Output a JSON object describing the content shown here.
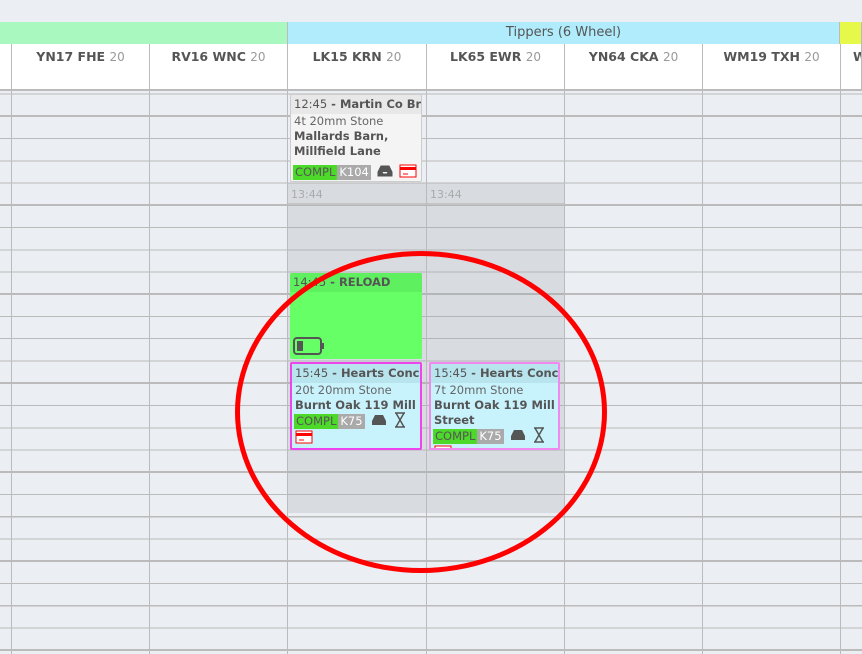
{
  "groups": [
    {
      "label": "",
      "color": "#a8f8c0"
    },
    {
      "label": "Tippers (6 Wheel)",
      "color": "#b0ecfc"
    },
    {
      "label": "",
      "color": "#e6f84a"
    }
  ],
  "columns": [
    {
      "reg": "YN17 FHE",
      "count": "20"
    },
    {
      "reg": "RV16 WNC",
      "count": "20"
    },
    {
      "reg": "LK15 KRN",
      "count": "20"
    },
    {
      "reg": "LK65 EWR",
      "count": "20"
    },
    {
      "reg": "YN64 CKA",
      "count": "20"
    },
    {
      "reg": "WM19 TXH",
      "count": "20"
    },
    {
      "reg": "W",
      "count": ""
    }
  ],
  "unavailable": {
    "label": "13:44"
  },
  "jobs": [
    {
      "time": "12:45",
      "customer": "Martin Co Brothers",
      "load": "4t 20mm Stone",
      "address": "Mallards Barn, Millfield Lane",
      "status": "COMPL",
      "ticket": "K104"
    },
    {
      "time": "14:45",
      "title": "RELOAD"
    },
    {
      "time": "15:45",
      "customer": "Hearts Concrete",
      "load": "20t 20mm Stone",
      "address": "Burnt Oak 119 Mill",
      "status": "COMPL",
      "ticket": "K75"
    },
    {
      "time": "15:45",
      "customer": "Hearts Concrete",
      "load": "7t 20mm Stone",
      "address": "Burnt Oak 119 Mill Street",
      "status": "COMPL",
      "ticket": "K75"
    }
  ],
  "separator": " - "
}
